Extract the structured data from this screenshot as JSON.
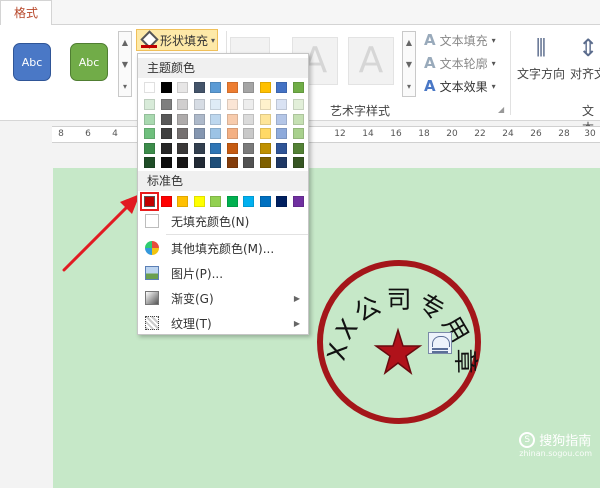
{
  "tab": {
    "label": "格式"
  },
  "ribbon": {
    "shape_style_buttons": [
      {
        "label": "Abc",
        "color": "#4a78c6"
      },
      {
        "label": "Abc",
        "color": "#71ac48"
      }
    ],
    "shape_fill_button": {
      "label": "形状填充"
    },
    "wordart_samples": [
      "A",
      "A"
    ],
    "text_commands": [
      {
        "label": "文本填充",
        "icon": "text-fill-icon"
      },
      {
        "label": "文本轮廓",
        "icon": "text-outline-icon"
      },
      {
        "label": "文本效果",
        "icon": "text-effects-icon"
      }
    ],
    "wordart_group_label": "艺术字样式",
    "text_direction_label": "文字方向",
    "align_text_label": "对齐文",
    "right_group_label": "文本"
  },
  "ruler": {
    "ticks": [
      "8",
      "6",
      "4",
      "12",
      "14",
      "16",
      "18",
      "20",
      "22",
      "24",
      "26",
      "28",
      "30"
    ]
  },
  "fill_menu": {
    "theme_colors_header": "主题颜色",
    "standard_colors_header": "标准色",
    "theme_colors": [
      [
        "#ffffff",
        "#000000",
        "#e7e6e6",
        "#44546a",
        "#5b9bd5",
        "#ed7d31",
        "#a5a5a5",
        "#ffc000",
        "#4472c4",
        "#70ad47"
      ],
      [
        "#d8ebd9",
        "#7f7f7f",
        "#d0cece",
        "#d6dce4",
        "#deebf6",
        "#fbe5d5",
        "#ededed",
        "#fff2cc",
        "#d9e2f3",
        "#e2efd9"
      ],
      [
        "#a9d9b0",
        "#595959",
        "#aeabab",
        "#adb9ca",
        "#bdd7ee",
        "#f7cbac",
        "#dbdbdb",
        "#fee599",
        "#b4c6e7",
        "#c5e0b3"
      ],
      [
        "#6fbf7d",
        "#3f3f3f",
        "#757070",
        "#8496b0",
        "#9cc3e5",
        "#f4b083",
        "#c9c9c9",
        "#ffd965",
        "#8eaadb",
        "#a8d08d"
      ],
      [
        "#3c8c4a",
        "#262626",
        "#3a3838",
        "#323f4f",
        "#2e75b5",
        "#c55a11",
        "#7b7b7b",
        "#bf9000",
        "#2f5496",
        "#538135"
      ],
      [
        "#1f4d27",
        "#0c0c0c",
        "#171616",
        "#222a35",
        "#1e4e79",
        "#833c0b",
        "#525252",
        "#7f6000",
        "#1f3864",
        "#375623"
      ]
    ],
    "standard_colors": [
      "#c00000",
      "#ff0000",
      "#ffc000",
      "#ffff00",
      "#92d050",
      "#00b050",
      "#00b0f0",
      "#0070c0",
      "#002060",
      "#7030a0"
    ],
    "selected_standard_index": 0,
    "items": [
      {
        "label": "无填充颜色(N)",
        "icon": "no-fill-icon",
        "has_submenu": false
      },
      {
        "label": "其他填充颜色(M)...",
        "icon": "color-palette-icon",
        "has_submenu": false
      },
      {
        "label": "图片(P)...",
        "icon": "picture-icon",
        "has_submenu": false
      },
      {
        "label": "渐变(G)",
        "icon": "gradient-icon",
        "has_submenu": true
      },
      {
        "label": "纹理(T)",
        "icon": "texture-icon",
        "has_submenu": true
      }
    ]
  },
  "stamp": {
    "arc_text": "XX公司专用章",
    "ring_color": "#a4161a",
    "star_color": "#b0121a"
  },
  "watermark": {
    "main": "搜狗指南",
    "sub": "zhinan.sogou.com"
  }
}
